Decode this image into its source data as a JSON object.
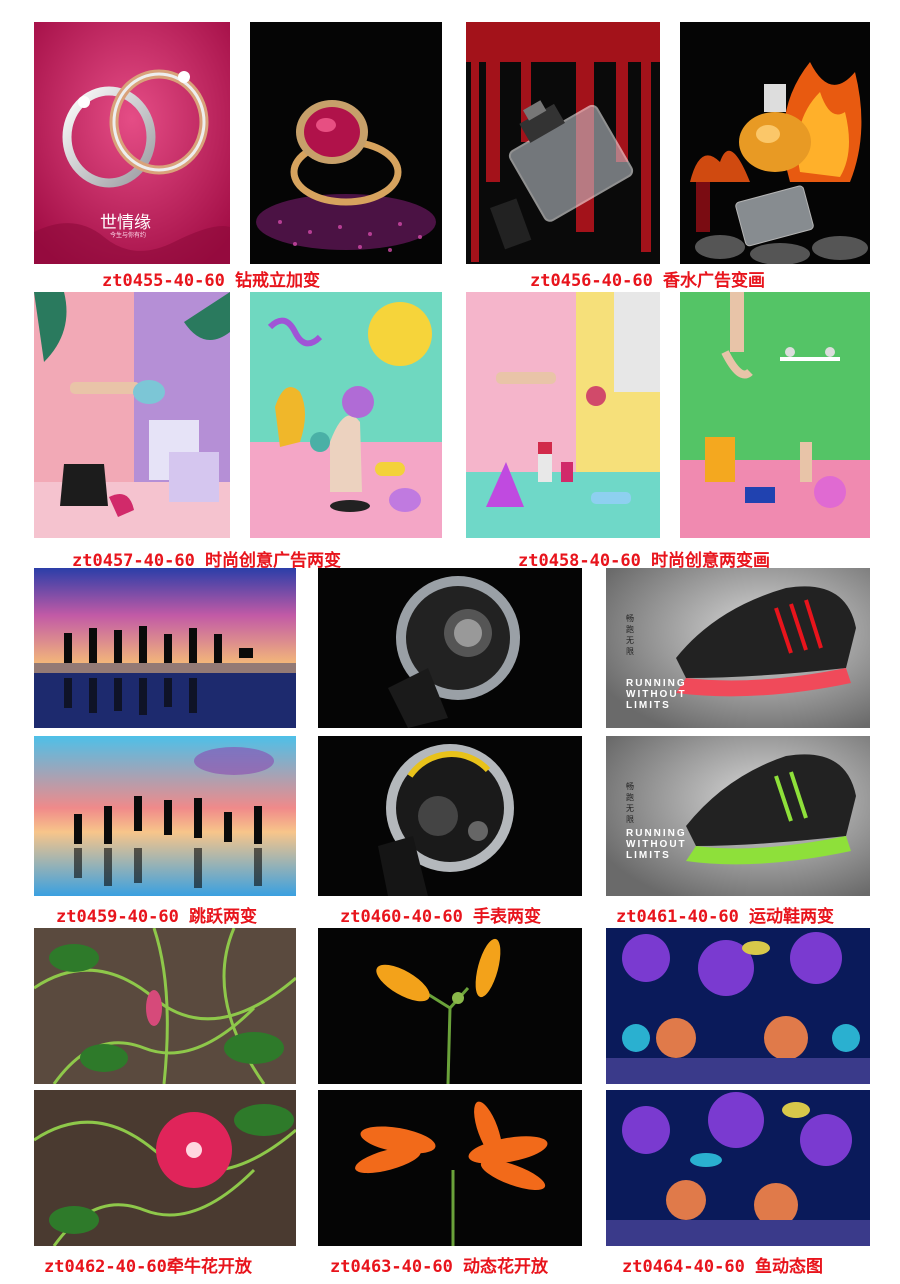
{
  "captions": [
    "zt0455-40-60  钻戒立加变",
    "zt0456-40-60  香水广告变画",
    "zt0457-40-60  时尚创意广告两变",
    "zt0458-40-60  时尚创意两变画",
    "zt0459-40-60 跳跃两变",
    "zt0460-40-60 手表两变",
    "zt0461-40-60 运动鞋两变",
    "zt0462-40-60牵牛花开放",
    "zt0463-40-60 动态花开放",
    "zt0464-40-60 鱼动态图"
  ],
  "ring_brand": "世情缘",
  "ring_tagline": "今生与你有约",
  "shoe_slogan_1": "RUNNING\nWITHOUT\nLIMITS",
  "shoe_slogan_2": "RUNNING\nWITHOUT\nLIMITS",
  "shoe_side_text": "畅跑无限",
  "colors": {
    "caption": "#e8141c",
    "ring_bg": "#c4185a",
    "perfume_bg": "#0a0a0a"
  }
}
